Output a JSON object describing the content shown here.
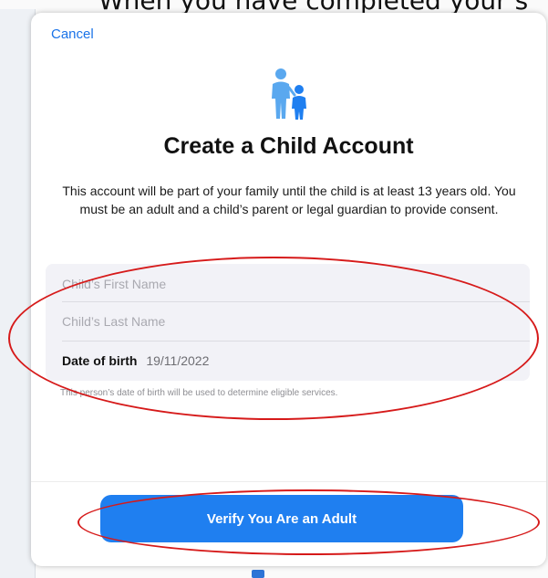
{
  "background": {
    "heading": "When you have completed your s"
  },
  "sheet": {
    "cancel_label": "Cancel",
    "icon": "family-icon",
    "title": "Create a Child Account",
    "description": "This account will be part of your family until the child is at least 13 years old. You must be an adult and a child’s parent or legal guardian to provide consent.",
    "form": {
      "first_name_placeholder": "Child’s First Name",
      "last_name_placeholder": "Child’s Last Name",
      "dob_label": "Date of birth",
      "dob_value": "19/11/2022"
    },
    "hint": "This person’s date of birth will be used to determine eligible services.",
    "verify_button_label": "Verify You Are an Adult"
  },
  "colors": {
    "accent": "#1f7ff0",
    "annotation": "#d61a1a"
  }
}
